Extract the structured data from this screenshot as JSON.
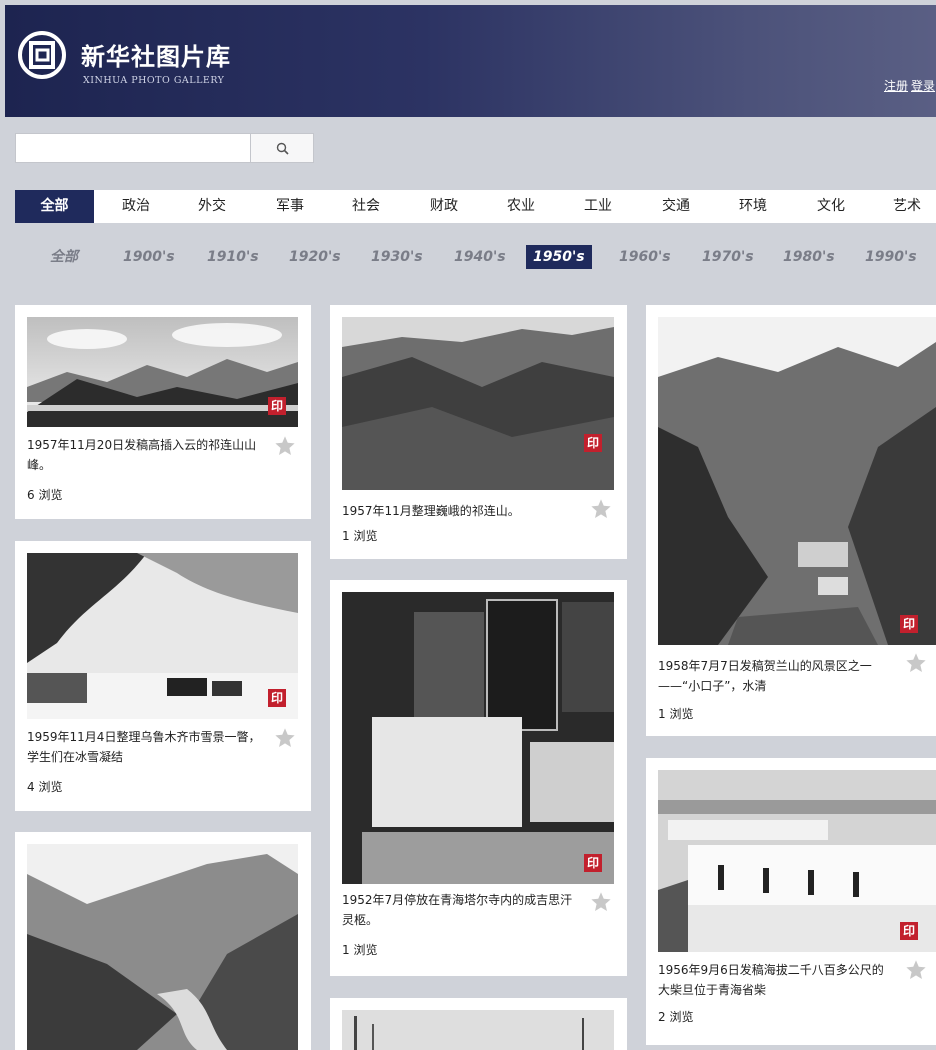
{
  "site": {
    "title": "新华社图片库",
    "subtitle": "XINHUA PHOTO GALLERY",
    "register": "注册",
    "login": "登录"
  },
  "search": {
    "placeholder": "",
    "icon": "search-icon"
  },
  "categories": [
    "全部",
    "政治",
    "外交",
    "军事",
    "社会",
    "财政",
    "农业",
    "工业",
    "交通",
    "环境",
    "文化",
    "艺术"
  ],
  "decades": [
    "全部",
    "1900's",
    "1910's",
    "1920's",
    "1930's",
    "1940's",
    "1950's",
    "1960's",
    "1970's",
    "1980's",
    "1990's"
  ],
  "active_category": "全部",
  "active_decade": "1950's",
  "stamp_glyph": "印",
  "cards": [
    {
      "caption": "1957年11月20日发稿高插入云的祁连山山峰。",
      "views": "6 浏览"
    },
    {
      "caption": "1959年11月4日整理乌鲁木齐市雪景一瞥，学生们在冰雪凝结",
      "views": "4 浏览"
    },
    {
      "caption": "",
      "views": ""
    },
    {
      "caption": "1957年11月整理巍峨的祁连山。",
      "views": "1 浏览"
    },
    {
      "caption": "1952年7月停放在青海塔尔寺内的成吉思汗灵柩。",
      "views": "1 浏览"
    },
    {
      "caption": "",
      "views": ""
    },
    {
      "caption": "1958年7月7日发稿贺兰山的风景区之一——“小口子”，水清",
      "views": "1 浏览"
    },
    {
      "caption": "1956年9月6日发稿海拔二千八百多公尺的大柴旦位于青海省柴",
      "views": "2 浏览"
    }
  ]
}
